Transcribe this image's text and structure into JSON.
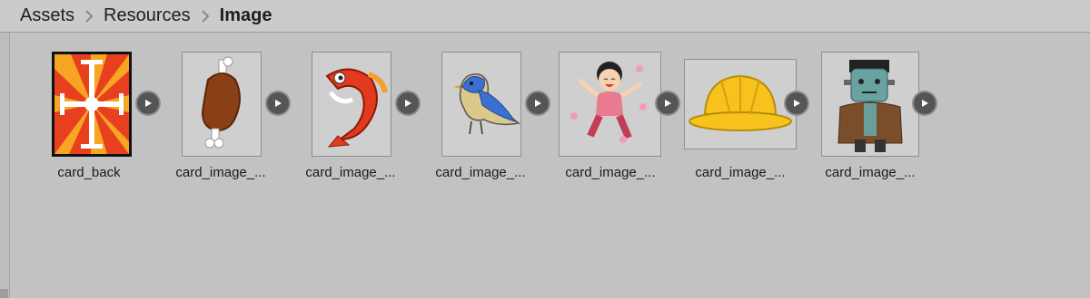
{
  "breadcrumb": {
    "items": [
      "Assets",
      "Resources",
      "Image"
    ]
  },
  "assets": [
    {
      "label": "card_back",
      "icon": "card-back-cross-icon"
    },
    {
      "label": "card_image_...",
      "icon": "meat-icon"
    },
    {
      "label": "card_image_...",
      "icon": "red-fish-icon"
    },
    {
      "label": "card_image_...",
      "icon": "blue-bird-icon"
    },
    {
      "label": "card_image_...",
      "icon": "happy-girl-icon"
    },
    {
      "label": "card_image_...",
      "icon": "yellow-hat-icon"
    },
    {
      "label": "card_image_...",
      "icon": "frankenstein-icon"
    }
  ],
  "colors": {
    "background": "#c2c2c2",
    "breadcrumb_bg": "#cbcbcb",
    "expand_button": "#555555"
  }
}
